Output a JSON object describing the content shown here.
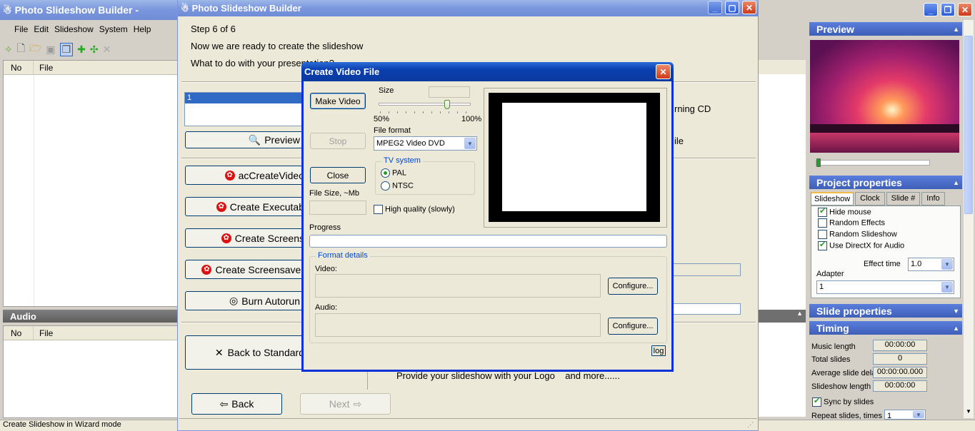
{
  "main_window": {
    "title": "Photo Slideshow Builder -",
    "menu": [
      "File",
      "Edit",
      "Slideshow",
      "System",
      "Help"
    ],
    "slides_columns": [
      "No",
      "File"
    ],
    "audio_title": "Audio",
    "audio_columns": [
      "No",
      "File"
    ],
    "status": "Create Slideshow in Wizard mode"
  },
  "right_panel": {
    "preview_title": "Preview",
    "project_title": "Project properties",
    "tabs": [
      "Slideshow",
      "Clock",
      "Slide #",
      "Info"
    ],
    "options": [
      {
        "label": "Hide mouse",
        "checked": true
      },
      {
        "label": "Random Effects",
        "checked": false
      },
      {
        "label": "Random Slideshow",
        "checked": false
      },
      {
        "label": "Use DirectX for Audio",
        "checked": true
      }
    ],
    "effect_time_label": "Effect time",
    "effect_time_value": "1.0",
    "adapter_label": "Adapter",
    "adapter_value": "1",
    "slide_props_title": "Slide properties",
    "timing_title": "Timing",
    "timing": [
      {
        "label": "Music length",
        "value": "00:00:00"
      },
      {
        "label": "Total slides",
        "value": "0"
      },
      {
        "label": "Average slide delay",
        "value": "00:00:00.000"
      },
      {
        "label": "Slideshow length",
        "value": "00:00:00"
      }
    ],
    "sync_label": "Sync by slides",
    "repeat_label": "Repeat slides, times",
    "repeat_value": "1"
  },
  "wizard": {
    "title": "Photo Slideshow Builder",
    "step": "Step 6 of 6",
    "line1": "Now we are ready to create the slideshow",
    "line2": "What to do with your presentation?",
    "list_item": "1",
    "preview_btn": "Preview",
    "actions": [
      "acCreateVideo",
      "Create Executab",
      "Create Screens",
      "Create Screensaver",
      "Burn Autorun"
    ],
    "right_text1": "rning CD",
    "right_text2": "ile",
    "back_std": "Back to Standard",
    "promo": "Provide your slideshow with your Logo    and more......",
    "back": "Back",
    "next": "Next"
  },
  "dialog": {
    "title": "Create Video File",
    "make_video": "Make Video",
    "stop": "Stop",
    "close": "Close",
    "size_label": "Size",
    "size_min": "50%",
    "size_max": "100%",
    "size_level_percent": 88,
    "file_format_label": "File format",
    "file_format_value": "MPEG2 Video DVD",
    "tv_system_label": "TV system",
    "tv_pal": "PAL",
    "tv_ntsc": "NTSC",
    "file_size_label": "File Size, ~Mb",
    "high_quality": "High quality (slowly)",
    "progress_label": "Progress",
    "progress_fraction": 0,
    "format_details": "Format details",
    "video_label": "Video:",
    "audio_label": "Audio:",
    "configure": "Configure...",
    "log": "log"
  }
}
